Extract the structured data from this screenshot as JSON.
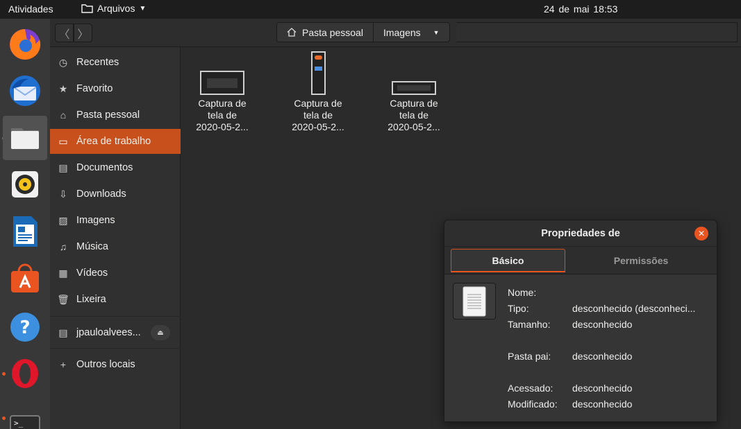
{
  "topbar": {
    "activities": "Atividades",
    "app_menu": "Arquivos",
    "clock": "24 de mai  18:53"
  },
  "dock": {
    "items": [
      {
        "name": "firefox",
        "active": false
      },
      {
        "name": "thunderbird",
        "active": false
      },
      {
        "name": "files",
        "active": true
      },
      {
        "name": "rhythmbox",
        "active": false
      },
      {
        "name": "libreoffice-writer",
        "active": false
      },
      {
        "name": "ubuntu-software",
        "active": false
      },
      {
        "name": "help",
        "active": false
      },
      {
        "name": "opera",
        "active": false
      },
      {
        "name": "terminal",
        "active": false
      }
    ],
    "terminal_prompt": ">_"
  },
  "header": {
    "crumbs": [
      "Pasta pessoal",
      "Imagens"
    ]
  },
  "sidebar": {
    "items": [
      {
        "label": "Recentes",
        "icon": "clock-icon"
      },
      {
        "label": "Favorito",
        "icon": "star-icon"
      },
      {
        "label": "Pasta pessoal",
        "icon": "home-icon"
      },
      {
        "label": "Área de trabalho",
        "icon": "desktop-icon"
      },
      {
        "label": "Documentos",
        "icon": "document-icon"
      },
      {
        "label": "Downloads",
        "icon": "download-icon"
      },
      {
        "label": "Imagens",
        "icon": "image-icon"
      },
      {
        "label": "Música",
        "icon": "music-icon"
      },
      {
        "label": "Vídeos",
        "icon": "film-icon"
      },
      {
        "label": "Lixeira",
        "icon": "trash-icon"
      }
    ],
    "drive": "jpauloalvees...",
    "other": "Outros locais"
  },
  "files": [
    {
      "line1": "Captura de",
      "line2": "tela de",
      "line3": "2020-05-2..."
    },
    {
      "line1": "Captura de",
      "line2": "tela de",
      "line3": "2020-05-2..."
    },
    {
      "line1": "Captura de",
      "line2": "tela de",
      "line3": "2020-05-2..."
    }
  ],
  "dialog": {
    "title": "Propriedades de",
    "tab_basic": "Básico",
    "tab_permissions": "Permissões",
    "props": {
      "name_label": "Nome:",
      "type_label": "Tipo:",
      "type_value": "desconhecido (desconheci...",
      "size_label": "Tamanho:",
      "size_value": "desconhecido",
      "parent_label": "Pasta pai:",
      "parent_value": "desconhecido",
      "accessed_label": "Acessado:",
      "accessed_value": "desconhecido",
      "modified_label": "Modificado:",
      "modified_value": "desconhecido"
    }
  },
  "colors": {
    "accent": "#e95420",
    "selection": "#c7501c"
  }
}
